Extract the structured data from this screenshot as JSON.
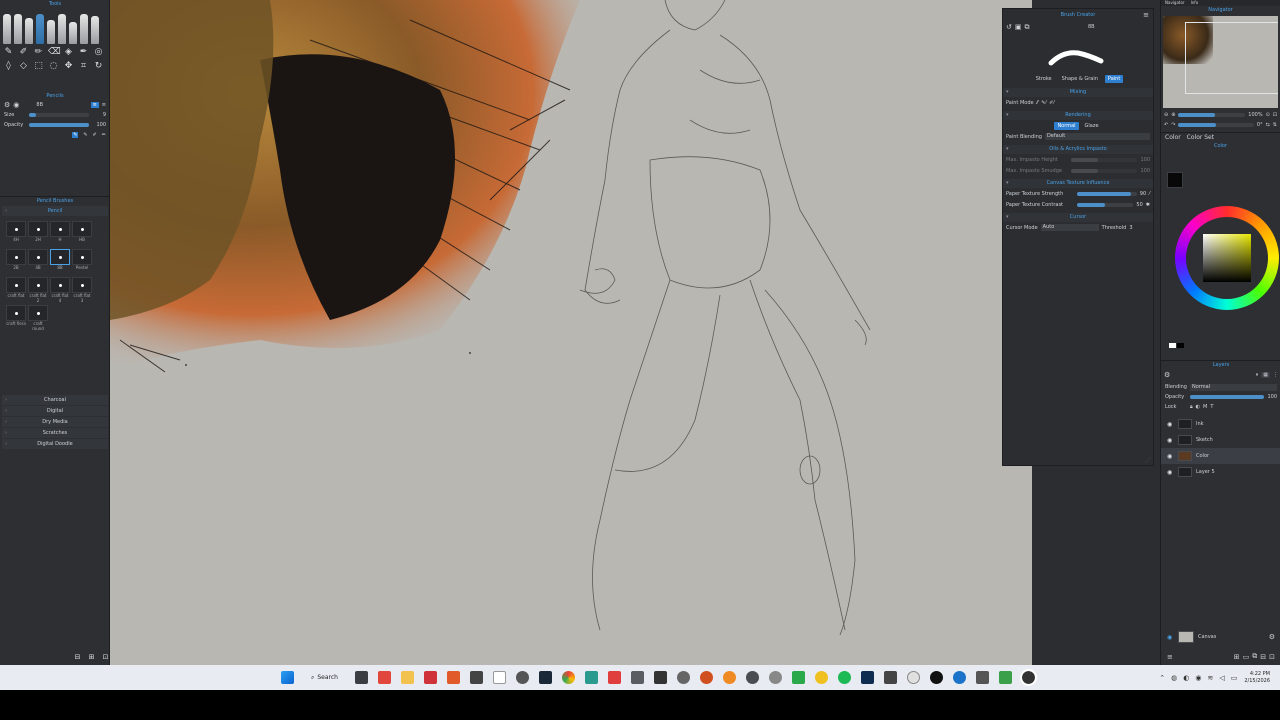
{
  "left_panel": {
    "tools_title": "Tools",
    "pencils_title": "Pencils",
    "brush_name": "8B",
    "size_label": "Size",
    "size_value": "9",
    "opacity_label": "Opacity",
    "opacity_value": "100",
    "brushes_title": "Pencil Brushes",
    "pencil_tab": "Pencil",
    "brushes": [
      {
        "label": "4H"
      },
      {
        "label": "2H"
      },
      {
        "label": "H"
      },
      {
        "label": "HB"
      },
      {
        "label": "2B"
      },
      {
        "label": "4B"
      },
      {
        "label": "8B"
      },
      {
        "label": "Pentel"
      },
      {
        "label": "craft flat"
      },
      {
        "label": "craft flat 2"
      },
      {
        "label": "craft flat 4"
      },
      {
        "label": "craft flat 3"
      },
      {
        "label": "craft fiera"
      },
      {
        "label": "craft round"
      }
    ],
    "categories": [
      "Charcoal",
      "Digital",
      "Dry Media",
      "Scratches",
      "Digital Doodle"
    ]
  },
  "brush_creator": {
    "title": "Brush Creator",
    "brush_name": "8B",
    "tabs": [
      {
        "label": "Stroke"
      },
      {
        "label": "Shape & Grain"
      },
      {
        "label": "Paint",
        "active": true
      }
    ],
    "mixing_title": "Mixing",
    "paint_mode_label": "Paint Mode",
    "rendering_title": "Rendering",
    "render_tabs": [
      {
        "label": "Normal",
        "active": true
      },
      {
        "label": "Glaze"
      }
    ],
    "paint_blending_label": "Paint Blending",
    "paint_blending_value": "Default",
    "impasto_title": "Oils & Acrylics Impasto",
    "max_impasto_height_label": "Max. Impasto Height",
    "max_impasto_height_value": "100",
    "max_impasto_smudge_label": "Max. Impasto Smudge",
    "max_impasto_smudge_value": "100",
    "texture_title": "Canvas Texture Influence",
    "paper_strength_label": "Paper Texture Strength",
    "paper_strength_value": "90",
    "paper_contrast_label": "Paper Texture Contrast",
    "paper_contrast_value": "50",
    "cursor_title": "Cursor",
    "cursor_mode_label": "Cursor Mode",
    "cursor_mode_value": "Auto",
    "threshold_label": "Threshold",
    "threshold_value": "3"
  },
  "right_panel": {
    "navigator_tab": "Navigator",
    "info_tab": "Info",
    "navigator_title": "Navigator",
    "zoom_value": "100%",
    "rotation_value": "0°",
    "color_tab": "Color",
    "color_set_tab": "Color Set",
    "color_title": "Color",
    "layers_title": "Layers",
    "blending_label": "Blending",
    "blending_value": "Normal",
    "opacity_label": "Opacity",
    "opacity_value": "100",
    "lock_label": "Lock",
    "layers": [
      {
        "name": "Ink"
      },
      {
        "name": "Sketch"
      },
      {
        "name": "Color",
        "active": true
      },
      {
        "name": "Layer 5"
      }
    ],
    "canvas_label": "Canvas"
  },
  "taskbar": {
    "search_label": "Search",
    "time": "4:22 PM",
    "date": "2/15/2026"
  },
  "colors": {
    "accent": "#4aa3e8",
    "active_tab": "#2f7fd0",
    "canvas_bg": "#b9b7b2",
    "panel_bg": "#2d2f33"
  }
}
